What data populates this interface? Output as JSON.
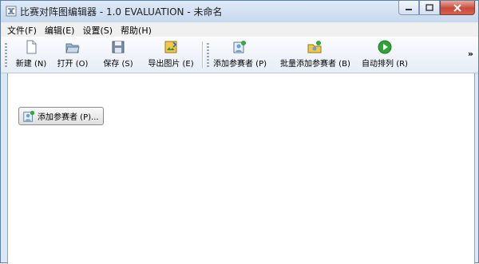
{
  "window": {
    "title": "比赛对阵图编辑器 - 1.0 EVALUATION - 未命名"
  },
  "menu": [
    "文件(F)",
    "编辑(E)",
    "设置(S)",
    "帮助(H)"
  ],
  "toolbar": {
    "new_label": "新建 (N)",
    "open_label": "打开 (O)",
    "save_label": "保存 (S)",
    "export_label": "导出图片 (E)",
    "add_participant_label": "添加参赛者 (P)",
    "batch_add_label": "批量添加参赛者 (B)",
    "auto_arrange_label": "自动排列 (R)",
    "overflow": "»"
  },
  "canvas": {
    "add_participant_button": "添加参赛者 (P)..."
  },
  "colors": {
    "title_bar": "#c6d8ee",
    "close_button": "#c74b3a",
    "auto_arrange_icon": "#2fa336"
  }
}
